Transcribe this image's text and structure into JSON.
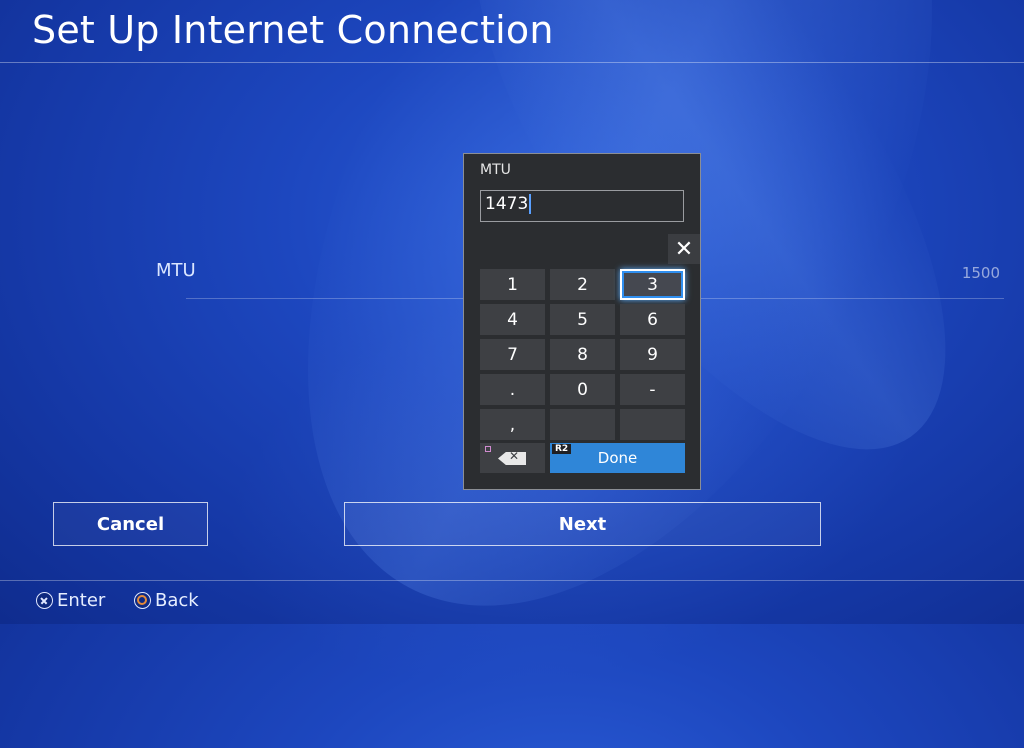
{
  "header": {
    "title": "Set Up Internet Connection"
  },
  "setting": {
    "label": "MTU",
    "value": "1500"
  },
  "keypad": {
    "label": "MTU",
    "input_value": "1473",
    "close_glyph": "✕",
    "keys": [
      "1",
      "2",
      "3",
      "4",
      "5",
      "6",
      "7",
      "8",
      "9",
      ".",
      "0",
      "-",
      ",",
      "",
      ""
    ],
    "focused_key": "3",
    "done_label": "Done",
    "done_badge": "R2"
  },
  "buttons": {
    "cancel": "Cancel",
    "next": "Next"
  },
  "footer": {
    "enter": "Enter",
    "back": "Back"
  },
  "colors": {
    "accent": "#2f86d8",
    "background": "#1d47bf"
  }
}
